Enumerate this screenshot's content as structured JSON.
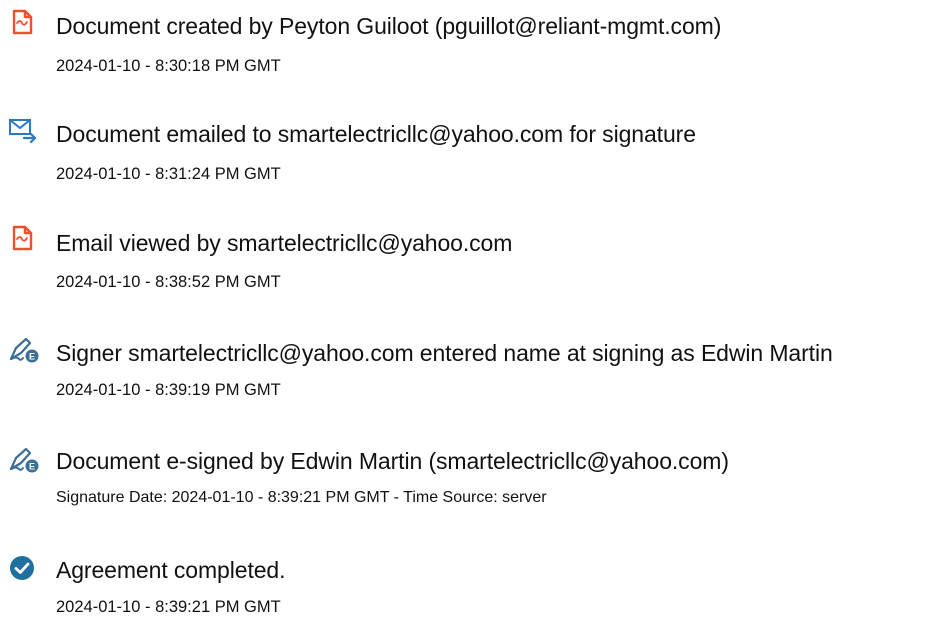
{
  "events": [
    {
      "icon": "document-icon",
      "title": "Document created by Peyton Guiloot (pguillot@reliant-mgmt.com)",
      "time": "2024-01-10 - 8:30:18 PM GMT"
    },
    {
      "icon": "email-send-icon",
      "title": "Document emailed to smartelectricllc@yahoo.com for signature",
      "time": "2024-01-10 - 8:31:24 PM GMT"
    },
    {
      "icon": "document-icon",
      "title": "Email viewed by smartelectricllc@yahoo.com",
      "time": "2024-01-10 - 8:38:52 PM GMT"
    },
    {
      "icon": "signature-pen-icon",
      "title": "Signer smartelectricllc@yahoo.com entered name at signing as Edwin Martin",
      "time": "2024-01-10 - 8:39:19 PM GMT"
    },
    {
      "icon": "signature-pen-icon",
      "title": "Document e-signed by Edwin Martin (smartelectricllc@yahoo.com)",
      "time": "Signature Date: 2024-01-10 - 8:39:21 PM GMT - Time Source: server"
    },
    {
      "icon": "check-circle-icon",
      "title": "Agreement completed.",
      "time": "2024-01-10 - 8:39:21 PM GMT"
    }
  ],
  "colors": {
    "document_icon": "#e8532d",
    "email_icon": "#2b79c2",
    "signature_icon": "#3a6f96",
    "check_icon": "#1f6fa0"
  }
}
